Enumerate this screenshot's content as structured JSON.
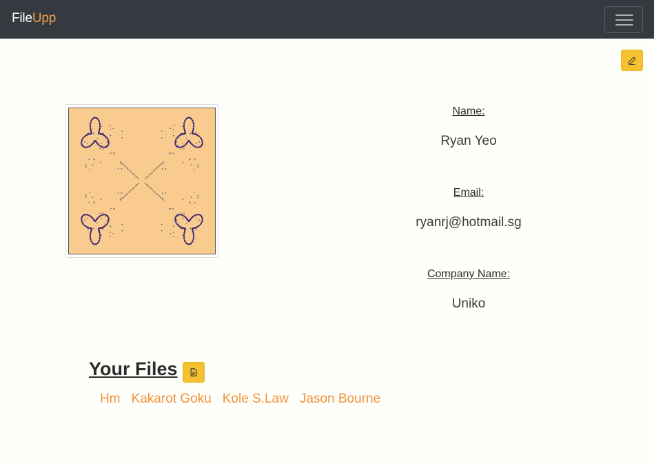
{
  "navbar": {
    "brand_part1": "File",
    "brand_part2": "Upp",
    "menu_icon": "hamburger-menu-icon"
  },
  "colors": {
    "navbar_bg": "#343a40",
    "brand_accent": "#f5a040",
    "warning_button": "#f4c130",
    "link": "#f0923a",
    "page_bg": "#fefffa",
    "avatar_bg": "#f9cb8f"
  },
  "profile": {
    "edit_icon": "pencil-icon",
    "name_label": "Name:",
    "name_value": "Ryan Yeo",
    "email_label": "Email:",
    "email_value": "ryanrj@hotmail.sg",
    "company_label": "Company Name:",
    "company_value": "Uniko"
  },
  "files": {
    "title": "Your Files",
    "add_icon": "file-document-icon",
    "items": [
      {
        "label": "Hm"
      },
      {
        "label": "Kakarot Goku"
      },
      {
        "label": "Kole S.Law"
      },
      {
        "label": "Jason Bourne"
      }
    ]
  }
}
